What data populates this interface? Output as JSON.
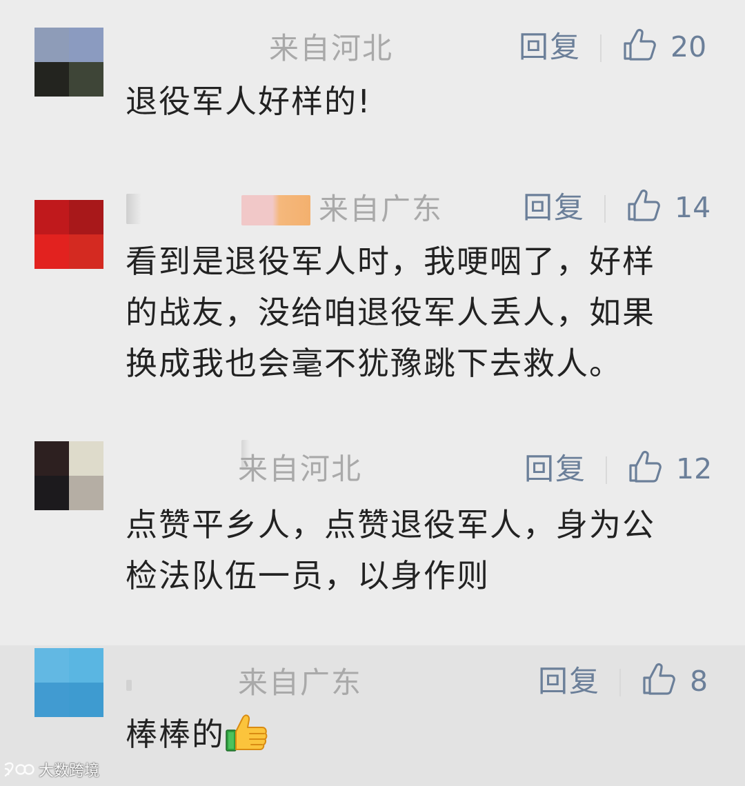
{
  "comments": [
    {
      "location": "来自河北",
      "reply_label": "回复",
      "like_icon": "thumbs-up-outline-icon",
      "likes": "20",
      "text_lines": [
        "退役军人好样的!"
      ],
      "avatar_colors": [
        "#8e9cb8",
        "#8b9bc0",
        "#23241f",
        "#3e4537"
      ]
    },
    {
      "location": "来自广东",
      "reply_label": "回复",
      "like_icon": "thumbs-up-outline-icon",
      "likes": "14",
      "text_lines": [
        "看到是退役军人时，我哽咽了，好样",
        "的战友，没给咱退役军人丢人，如果",
        "换成我也会毫不犹豫跳下去救人。"
      ],
      "avatar_colors": [
        "#c0191c",
        "#a8181a",
        "#e2221f",
        "#d42a21"
      ]
    },
    {
      "location": "来自河北",
      "reply_label": "回复",
      "like_icon": "thumbs-up-outline-icon",
      "likes": "12",
      "text_lines": [
        "点赞平乡人，点赞退役军人，身为公",
        "检法队伍一员，以身作则"
      ],
      "avatar_colors": [
        "#2d2020",
        "#dedbcb",
        "#1c1a1d",
        "#b5aea4"
      ]
    },
    {
      "location": "来自广东",
      "reply_label": "回复",
      "like_icon": "thumbs-up-outline-icon",
      "likes": "8",
      "text": "棒棒的",
      "emoji": "thumbs-up-emoji-icon",
      "avatar_colors": [
        "#62b8e3",
        "#5ab6e2",
        "#419bd1",
        "#3e9bd0"
      ]
    }
  ],
  "watermark": {
    "text": "大数跨境",
    "icon": "dashujiajing-logo-icon"
  },
  "colors": {
    "background": "#ececec",
    "meta_text": "#a9a9a9",
    "action_text": "#6b7f99",
    "body_text": "#222222"
  }
}
